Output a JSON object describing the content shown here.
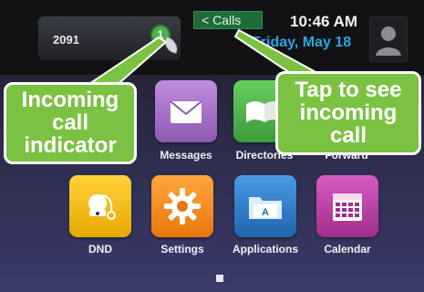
{
  "status_bar": {
    "extension": "2091",
    "incoming_call_count": "1",
    "calls_tab_label": "Calls",
    "time": "10:46 AM",
    "date": "Friday, May 18"
  },
  "apps": [
    {
      "label": "Messages",
      "icon": "envelope-icon",
      "color": "#a979c8"
    },
    {
      "label": "Directories",
      "icon": "book-icon",
      "color": "#4cae4c"
    },
    {
      "label": "Forward",
      "icon": "forward-icon",
      "color": "#ffffff"
    },
    {
      "label": "DND",
      "icon": "dnd-icon",
      "color": "#e6b000"
    },
    {
      "label": "Settings",
      "icon": "gear-icon",
      "color": "#ff8e1a"
    },
    {
      "label": "Applications",
      "icon": "folder-icon",
      "color": "#2f7cc7"
    },
    {
      "label": "Calendar",
      "icon": "calendar-icon",
      "color": "#b33a9f"
    }
  ],
  "callouts": {
    "left_lines": [
      "Incoming",
      "call",
      "indicator"
    ],
    "right_lines": [
      "Tap to see",
      "incoming",
      "call"
    ]
  },
  "colors": {
    "callout_green": "#7cc242",
    "date_blue": "#28a9e2",
    "calls_tab": "#1f6b3a"
  }
}
